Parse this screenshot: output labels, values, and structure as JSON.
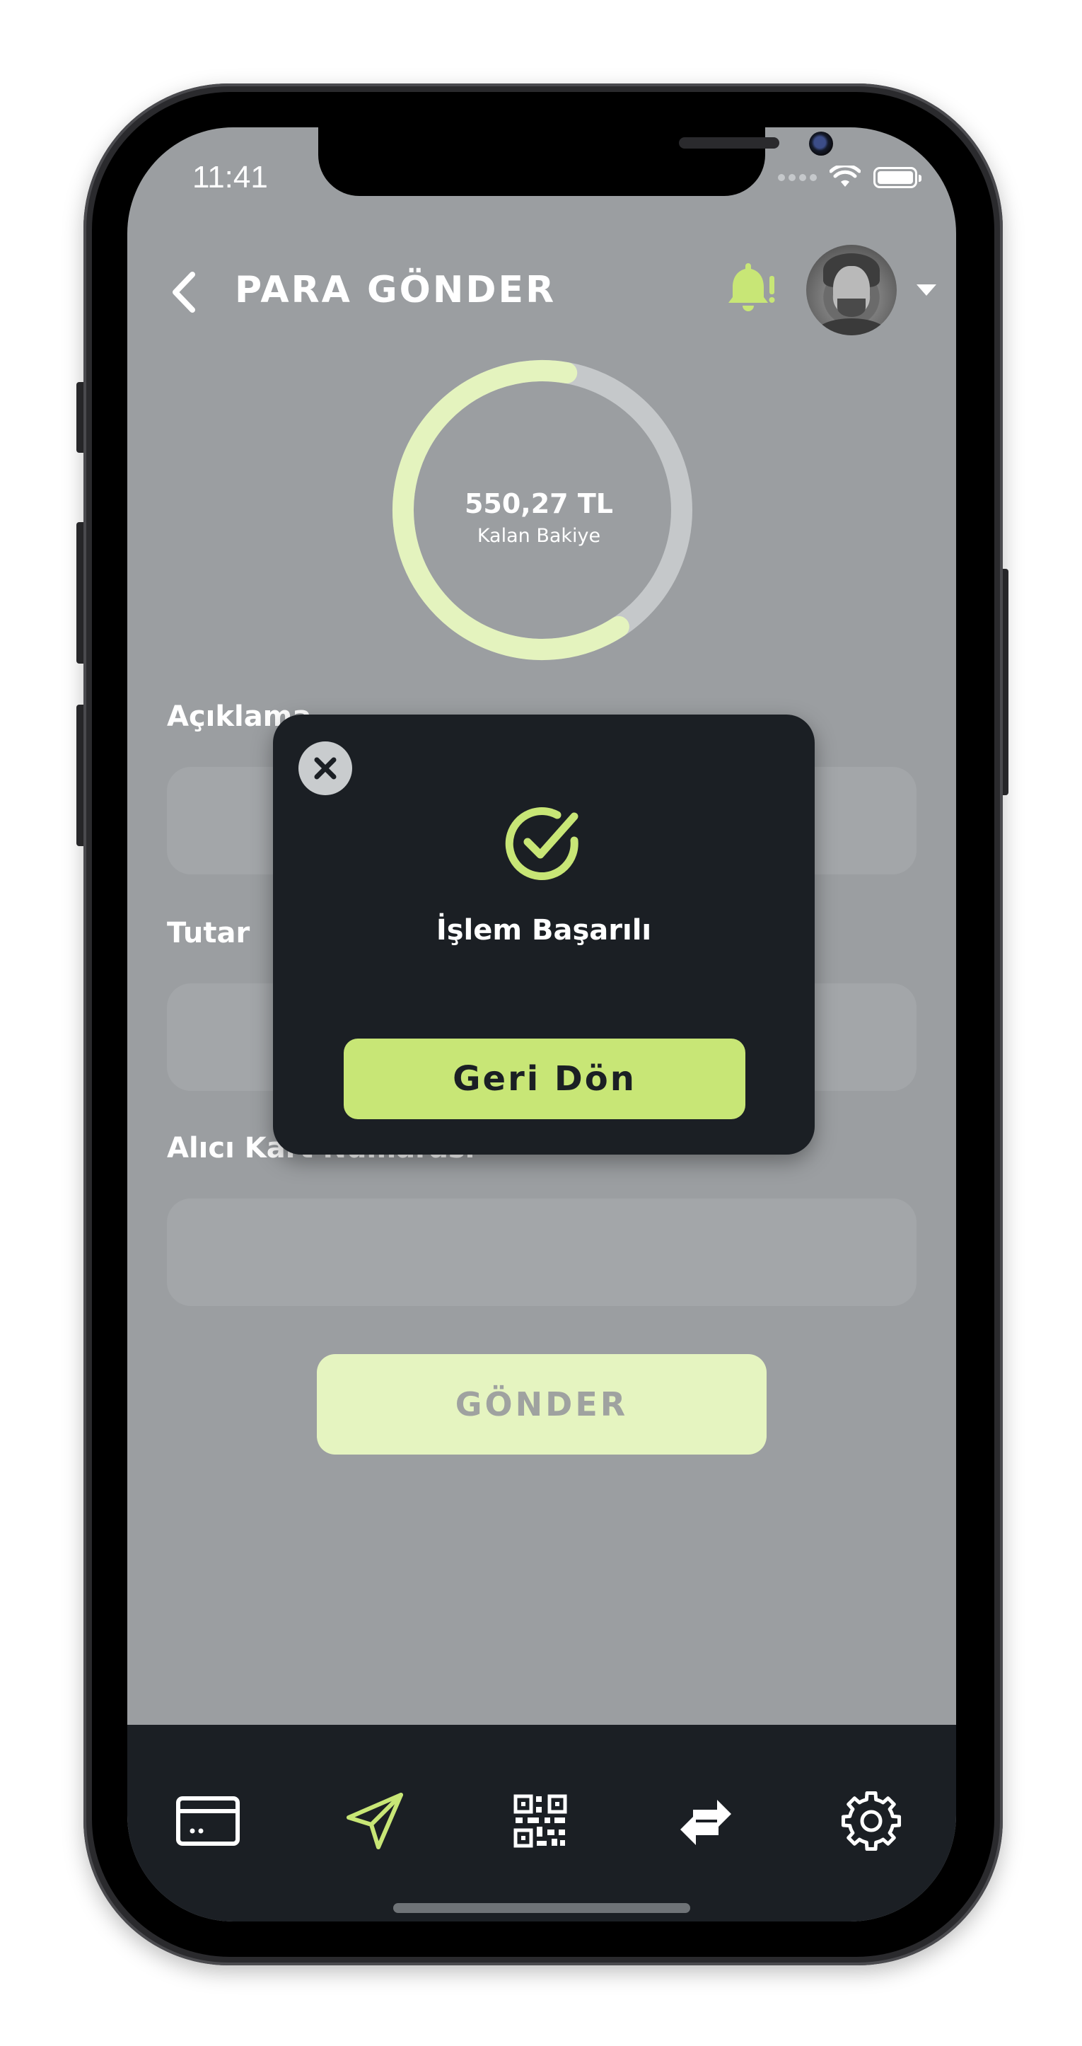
{
  "status_bar": {
    "time": "11:41"
  },
  "header": {
    "title": "PARA GÖNDER",
    "back_icon": "chevron-left-icon",
    "notification_icon": "bell-alert-icon",
    "avatar_icon": "user-avatar",
    "dropdown_icon": "caret-down-icon"
  },
  "balance": {
    "amount": "550,27 TL",
    "label": "Kalan Bakiye",
    "remaining_fraction": 0.62
  },
  "form": {
    "fields": [
      {
        "label": "Açıklama",
        "value": ""
      },
      {
        "label": "Tutar",
        "value": ""
      },
      {
        "label": "Alıcı Kart Numarası",
        "value": ""
      }
    ],
    "submit_label": "GÖNDER"
  },
  "modal": {
    "close_icon": "close-icon",
    "status_icon": "check-circle-icon",
    "message": "İşlem Başarılı",
    "button_label": "Geri Dön"
  },
  "tab_bar": {
    "items": [
      {
        "name": "cards",
        "icon": "credit-card-icon",
        "active": false
      },
      {
        "name": "send",
        "icon": "paper-plane-icon",
        "active": true
      },
      {
        "name": "qr",
        "icon": "qr-code-icon",
        "active": false
      },
      {
        "name": "transfer",
        "icon": "swap-arrows-icon",
        "active": false
      },
      {
        "name": "settings",
        "icon": "gear-icon",
        "active": false
      }
    ]
  },
  "colors": {
    "accent": "#c8e676",
    "accent_light": "#e5f4c0",
    "dark": "#1b1f24",
    "overlay_bg": "#9b9ea1"
  }
}
